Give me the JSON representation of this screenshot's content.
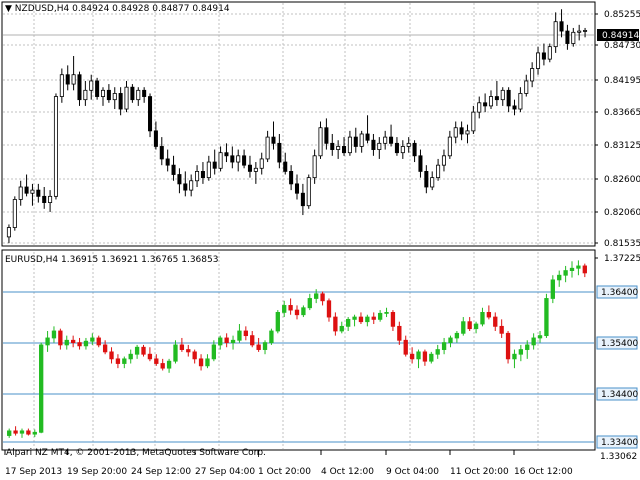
{
  "top_panel": {
    "symbol": "NZDUSD,H4",
    "ohlc": "0.84924 0.84928 0.84877 0.84914",
    "price_labels": [
      "0.85255",
      "0.84730",
      "0.84195",
      "0.83665",
      "0.83125",
      "0.82600",
      "0.82060",
      "0.81535"
    ],
    "current_price": "0.84914",
    "yrange": [
      0.8147,
      0.8535
    ],
    "candles": [
      [
        0.816,
        0.818,
        0.815,
        0.8175
      ],
      [
        0.8175,
        0.8225,
        0.817,
        0.822
      ],
      [
        0.822,
        0.825,
        0.821,
        0.824
      ],
      [
        0.824,
        0.826,
        0.8225,
        0.823
      ],
      [
        0.823,
        0.8245,
        0.821,
        0.8235
      ],
      [
        0.8235,
        0.8245,
        0.8215,
        0.8225
      ],
      [
        0.8225,
        0.824,
        0.8205,
        0.8215
      ],
      [
        0.8215,
        0.8235,
        0.82,
        0.8225
      ],
      [
        0.8225,
        0.839,
        0.822,
        0.8385
      ],
      [
        0.8385,
        0.843,
        0.8375,
        0.842
      ],
      [
        0.842,
        0.8435,
        0.8395,
        0.8405
      ],
      [
        0.8405,
        0.845,
        0.8395,
        0.842
      ],
      [
        0.842,
        0.8425,
        0.837,
        0.838
      ],
      [
        0.838,
        0.841,
        0.837,
        0.8395
      ],
      [
        0.8395,
        0.842,
        0.838,
        0.841
      ],
      [
        0.841,
        0.8415,
        0.838,
        0.8385
      ],
      [
        0.8385,
        0.84,
        0.837,
        0.8395
      ],
      [
        0.8395,
        0.8405,
        0.8375,
        0.838
      ],
      [
        0.838,
        0.84,
        0.8365,
        0.839
      ],
      [
        0.839,
        0.84,
        0.8355,
        0.8365
      ],
      [
        0.8365,
        0.841,
        0.836,
        0.84
      ],
      [
        0.84,
        0.8405,
        0.8375,
        0.838
      ],
      [
        0.838,
        0.84,
        0.837,
        0.8395
      ],
      [
        0.8395,
        0.84,
        0.8375,
        0.8385
      ],
      [
        0.8385,
        0.839,
        0.832,
        0.833
      ],
      [
        0.833,
        0.8345,
        0.83,
        0.8305
      ],
      [
        0.8305,
        0.832,
        0.8275,
        0.8285
      ],
      [
        0.8285,
        0.83,
        0.8265,
        0.8275
      ],
      [
        0.8275,
        0.829,
        0.825,
        0.826
      ],
      [
        0.826,
        0.827,
        0.823,
        0.8245
      ],
      [
        0.8245,
        0.8265,
        0.8225,
        0.8235
      ],
      [
        0.8235,
        0.826,
        0.8225,
        0.825
      ],
      [
        0.825,
        0.8275,
        0.824,
        0.8265
      ],
      [
        0.8265,
        0.828,
        0.8245,
        0.8255
      ],
      [
        0.8255,
        0.829,
        0.825,
        0.828
      ],
      [
        0.828,
        0.83,
        0.826,
        0.827
      ],
      [
        0.827,
        0.8305,
        0.8265,
        0.8295
      ],
      [
        0.8295,
        0.831,
        0.828,
        0.829
      ],
      [
        0.829,
        0.8305,
        0.827,
        0.828
      ],
      [
        0.828,
        0.83,
        0.8265,
        0.829
      ],
      [
        0.829,
        0.83,
        0.827,
        0.8275
      ],
      [
        0.8275,
        0.829,
        0.8255,
        0.8265
      ],
      [
        0.8265,
        0.828,
        0.8245,
        0.827
      ],
      [
        0.827,
        0.8295,
        0.826,
        0.8285
      ],
      [
        0.8285,
        0.833,
        0.828,
        0.832
      ],
      [
        0.832,
        0.8345,
        0.83,
        0.831
      ],
      [
        0.831,
        0.8325,
        0.827,
        0.828
      ],
      [
        0.828,
        0.8295,
        0.826,
        0.8265
      ],
      [
        0.8265,
        0.8275,
        0.8235,
        0.8245
      ],
      [
        0.8245,
        0.826,
        0.822,
        0.823
      ],
      [
        0.823,
        0.8245,
        0.8195,
        0.821
      ],
      [
        0.821,
        0.826,
        0.8205,
        0.8255
      ],
      [
        0.8255,
        0.83,
        0.8245,
        0.829
      ],
      [
        0.829,
        0.8345,
        0.8285,
        0.8335
      ],
      [
        0.8335,
        0.835,
        0.83,
        0.831
      ],
      [
        0.831,
        0.8325,
        0.829,
        0.83
      ],
      [
        0.83,
        0.8315,
        0.8285,
        0.8305
      ],
      [
        0.8305,
        0.832,
        0.829,
        0.8295
      ],
      [
        0.8295,
        0.833,
        0.829,
        0.832
      ],
      [
        0.832,
        0.8335,
        0.8295,
        0.8305
      ],
      [
        0.8305,
        0.833,
        0.8295,
        0.8325
      ],
      [
        0.8325,
        0.8355,
        0.831,
        0.8315
      ],
      [
        0.8315,
        0.8325,
        0.829,
        0.83
      ],
      [
        0.83,
        0.832,
        0.8285,
        0.831
      ],
      [
        0.831,
        0.833,
        0.83,
        0.832
      ],
      [
        0.832,
        0.834,
        0.8305,
        0.831
      ],
      [
        0.831,
        0.832,
        0.829,
        0.8295
      ],
      [
        0.8295,
        0.8315,
        0.8285,
        0.8305
      ],
      [
        0.8305,
        0.832,
        0.8295,
        0.831
      ],
      [
        0.831,
        0.8315,
        0.828,
        0.829
      ],
      [
        0.829,
        0.83,
        0.8255,
        0.8265
      ],
      [
        0.8265,
        0.8275,
        0.823,
        0.824
      ],
      [
        0.824,
        0.8265,
        0.8235,
        0.8255
      ],
      [
        0.8255,
        0.8285,
        0.825,
        0.8275
      ],
      [
        0.8275,
        0.83,
        0.8265,
        0.829
      ],
      [
        0.829,
        0.833,
        0.8285,
        0.832
      ],
      [
        0.832,
        0.8345,
        0.831,
        0.8335
      ],
      [
        0.8335,
        0.8345,
        0.8315,
        0.8325
      ],
      [
        0.8325,
        0.834,
        0.831,
        0.833
      ],
      [
        0.833,
        0.837,
        0.8325,
        0.836
      ],
      [
        0.836,
        0.8385,
        0.835,
        0.8375
      ],
      [
        0.8375,
        0.839,
        0.836,
        0.837
      ],
      [
        0.837,
        0.8395,
        0.8365,
        0.8385
      ],
      [
        0.8385,
        0.841,
        0.837,
        0.838
      ],
      [
        0.838,
        0.84,
        0.837,
        0.8395
      ],
      [
        0.8395,
        0.84,
        0.836,
        0.837
      ],
      [
        0.837,
        0.838,
        0.8355,
        0.8365
      ],
      [
        0.8365,
        0.84,
        0.836,
        0.839
      ],
      [
        0.839,
        0.842,
        0.8385,
        0.841
      ],
      [
        0.841,
        0.844,
        0.84,
        0.843
      ],
      [
        0.843,
        0.8465,
        0.842,
        0.8455
      ],
      [
        0.8455,
        0.847,
        0.8435,
        0.8445
      ],
      [
        0.8445,
        0.847,
        0.844,
        0.8465
      ],
      [
        0.8465,
        0.852,
        0.8455,
        0.8505
      ],
      [
        0.8505,
        0.8525,
        0.848,
        0.849
      ],
      [
        0.849,
        0.85,
        0.846,
        0.847
      ],
      [
        0.847,
        0.8495,
        0.8465,
        0.8488
      ],
      [
        0.8488,
        0.85,
        0.8475,
        0.849
      ],
      [
        0.849,
        0.8495,
        0.848,
        0.8491
      ]
    ]
  },
  "bottom_panel": {
    "symbol": "EURUSD,H4",
    "ohlc": "1.36915 1.36921 1.36765 1.36853",
    "price_labels": [
      "1.37225",
      "1.36400",
      "1.35400",
      "1.34400",
      "1.33400",
      "1.33062"
    ],
    "level_labels": [
      "1.36400",
      "1.35400",
      "1.34400",
      "1.33400"
    ],
    "yrange": [
      1.3306,
      1.373
    ],
    "candles": [
      [
        1.3335,
        1.335,
        1.333,
        1.3345
      ],
      [
        1.3345,
        1.3355,
        1.3335,
        1.334
      ],
      [
        1.334,
        1.335,
        1.333,
        1.3345
      ],
      [
        1.3345,
        1.335,
        1.3335,
        1.3338
      ],
      [
        1.3338,
        1.3348,
        1.3332,
        1.3342
      ],
      [
        1.3342,
        1.3535,
        1.334,
        1.353
      ],
      [
        1.353,
        1.356,
        1.3515,
        1.3545
      ],
      [
        1.3545,
        1.357,
        1.3535,
        1.356
      ],
      [
        1.356,
        1.3565,
        1.352,
        1.353
      ],
      [
        1.353,
        1.355,
        1.352,
        1.354
      ],
      [
        1.354,
        1.355,
        1.3525,
        1.3535
      ],
      [
        1.3535,
        1.3545,
        1.352,
        1.3528
      ],
      [
        1.3528,
        1.3545,
        1.352,
        1.3538
      ],
      [
        1.3538,
        1.3555,
        1.353,
        1.3545
      ],
      [
        1.3545,
        1.355,
        1.3525,
        1.353
      ],
      [
        1.353,
        1.354,
        1.351,
        1.3515
      ],
      [
        1.3515,
        1.3525,
        1.349,
        1.35
      ],
      [
        1.35,
        1.351,
        1.348,
        1.349
      ],
      [
        1.349,
        1.3505,
        1.348,
        1.35
      ],
      [
        1.35,
        1.352,
        1.349,
        1.351
      ],
      [
        1.351,
        1.353,
        1.35,
        1.3525
      ],
      [
        1.3525,
        1.353,
        1.3505,
        1.351
      ],
      [
        1.351,
        1.3525,
        1.3495,
        1.35
      ],
      [
        1.35,
        1.351,
        1.3485,
        1.349
      ],
      [
        1.349,
        1.35,
        1.3475,
        1.348
      ],
      [
        1.348,
        1.35,
        1.347,
        1.3495
      ],
      [
        1.3495,
        1.354,
        1.349,
        1.353
      ],
      [
        1.353,
        1.3545,
        1.3515,
        1.352
      ],
      [
        1.352,
        1.353,
        1.3505,
        1.3515
      ],
      [
        1.3515,
        1.352,
        1.349,
        1.35
      ],
      [
        1.35,
        1.351,
        1.3475,
        1.3485
      ],
      [
        1.3485,
        1.351,
        1.348,
        1.35
      ],
      [
        1.35,
        1.354,
        1.3495,
        1.353
      ],
      [
        1.353,
        1.355,
        1.352,
        1.3545
      ],
      [
        1.3545,
        1.3555,
        1.3525,
        1.3535
      ],
      [
        1.3535,
        1.355,
        1.352,
        1.354
      ],
      [
        1.354,
        1.3575,
        1.3535,
        1.356
      ],
      [
        1.356,
        1.357,
        1.354,
        1.355
      ],
      [
        1.355,
        1.356,
        1.3525,
        1.353
      ],
      [
        1.353,
        1.3545,
        1.3515,
        1.352
      ],
      [
        1.352,
        1.354,
        1.351,
        1.3535
      ],
      [
        1.3535,
        1.3565,
        1.353,
        1.356
      ],
      [
        1.356,
        1.3605,
        1.3555,
        1.36
      ],
      [
        1.36,
        1.3625,
        1.359,
        1.3615
      ],
      [
        1.3615,
        1.363,
        1.3595,
        1.3605
      ],
      [
        1.3605,
        1.3615,
        1.3585,
        1.3595
      ],
      [
        1.3595,
        1.3615,
        1.359,
        1.361
      ],
      [
        1.361,
        1.364,
        1.3605,
        1.363
      ],
      [
        1.363,
        1.365,
        1.362,
        1.364
      ],
      [
        1.364,
        1.3645,
        1.3615,
        1.3625
      ],
      [
        1.3625,
        1.363,
        1.358,
        1.359
      ],
      [
        1.359,
        1.36,
        1.355,
        1.356
      ],
      [
        1.356,
        1.358,
        1.3555,
        1.357
      ],
      [
        1.357,
        1.359,
        1.356,
        1.3585
      ],
      [
        1.3585,
        1.3595,
        1.357,
        1.359
      ],
      [
        1.359,
        1.36,
        1.3575,
        1.358
      ],
      [
        1.358,
        1.3595,
        1.357,
        1.359
      ],
      [
        1.359,
        1.36,
        1.3575,
        1.3585
      ],
      [
        1.3585,
        1.3605,
        1.358,
        1.3598
      ],
      [
        1.3598,
        1.361,
        1.359,
        1.36
      ],
      [
        1.36,
        1.3605,
        1.356,
        1.357
      ],
      [
        1.357,
        1.358,
        1.353,
        1.354
      ],
      [
        1.354,
        1.355,
        1.3505,
        1.351
      ],
      [
        1.351,
        1.3525,
        1.349,
        1.35
      ],
      [
        1.35,
        1.352,
        1.348,
        1.3515
      ],
      [
        1.3515,
        1.352,
        1.3485,
        1.3495
      ],
      [
        1.3495,
        1.3515,
        1.349,
        1.351
      ],
      [
        1.351,
        1.353,
        1.35,
        1.352
      ],
      [
        1.352,
        1.3545,
        1.351,
        1.3535
      ],
      [
        1.3535,
        1.355,
        1.3525,
        1.3545
      ],
      [
        1.3545,
        1.356,
        1.3535,
        1.3555
      ],
      [
        1.3555,
        1.359,
        1.355,
        1.358
      ],
      [
        1.358,
        1.359,
        1.356,
        1.3565
      ],
      [
        1.3565,
        1.358,
        1.3555,
        1.3575
      ],
      [
        1.3575,
        1.361,
        1.357,
        1.36
      ],
      [
        1.36,
        1.3615,
        1.3585,
        1.359
      ],
      [
        1.359,
        1.36,
        1.356,
        1.357
      ],
      [
        1.357,
        1.3585,
        1.3545,
        1.3555
      ],
      [
        1.3555,
        1.356,
        1.349,
        1.35
      ],
      [
        1.35,
        1.352,
        1.348,
        1.351
      ],
      [
        1.351,
        1.353,
        1.3495,
        1.352
      ],
      [
        1.352,
        1.354,
        1.35,
        1.353
      ],
      [
        1.353,
        1.3555,
        1.352,
        1.3545
      ],
      [
        1.3545,
        1.356,
        1.3535,
        1.355
      ],
      [
        1.355,
        1.364,
        1.3545,
        1.363
      ],
      [
        1.363,
        1.368,
        1.362,
        1.367
      ],
      [
        1.367,
        1.369,
        1.3655,
        1.368
      ],
      [
        1.368,
        1.37,
        1.3665,
        1.369
      ],
      [
        1.369,
        1.371,
        1.3675,
        1.3695
      ],
      [
        1.3695,
        1.3712,
        1.368,
        1.37
      ],
      [
        1.37,
        1.3705,
        1.3676,
        1.3685
      ]
    ]
  },
  "x_axis": {
    "labels": [
      "17 Sep 2013",
      "19 Sep 20:00",
      "24 Sep 12:00",
      "27 Sep 04:00",
      "1 Oct 20:00",
      "4 Oct 12:00",
      "9 Oct 04:00",
      "11 Oct 20:00",
      "16 Oct 12:00"
    ]
  },
  "copyright": "Alpari NZ MT4, © 2001-2013, MetaQuotes Software Corp.",
  "colors": {
    "bull_top": "#ffffff",
    "bear_top": "#000000",
    "bull_bottom": "#22bb22",
    "bear_bottom": "#dd1111",
    "grid": "#c0c0c0",
    "level_line": "#4a90c8",
    "price_line": "#b0b0b0"
  }
}
